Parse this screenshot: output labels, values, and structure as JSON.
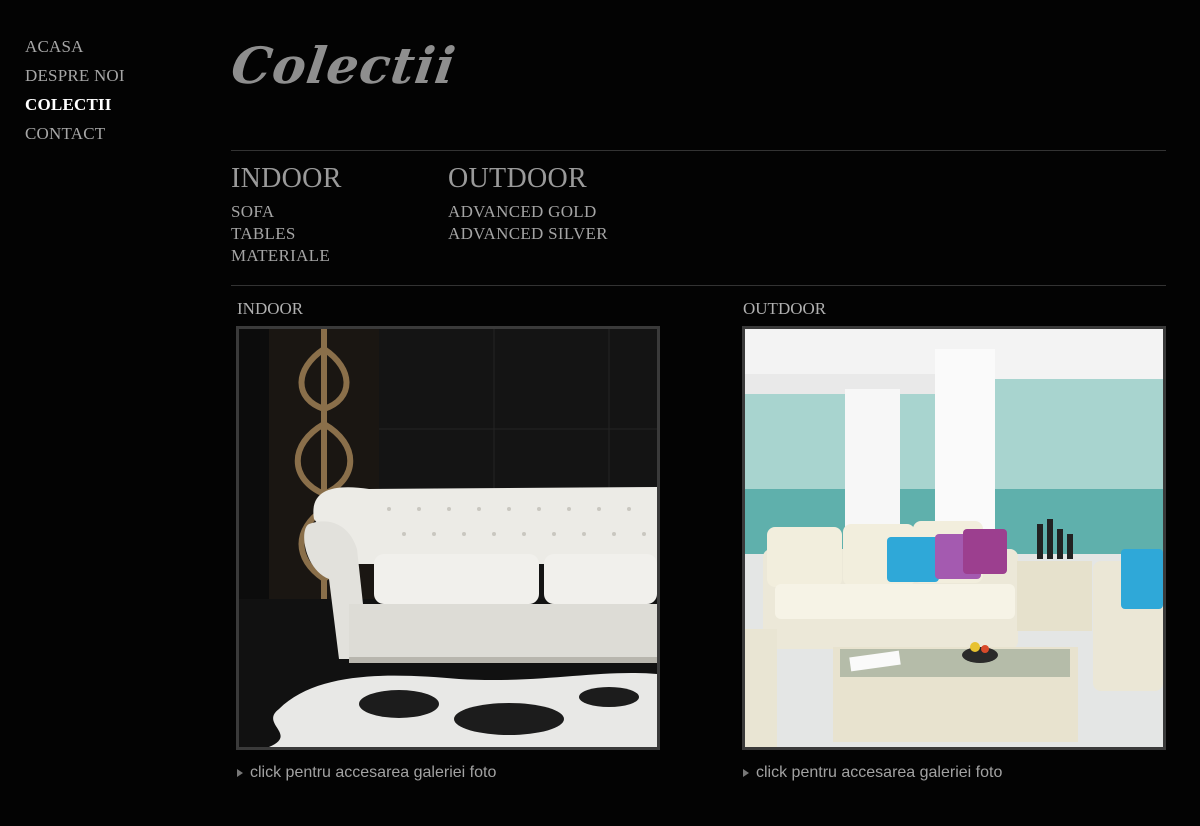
{
  "nav": {
    "items": [
      {
        "label": "ACASA",
        "active": false
      },
      {
        "label": "DESPRE NOI",
        "active": false
      },
      {
        "label": "COLECTII",
        "active": true
      },
      {
        "label": "CONTACT",
        "active": false
      }
    ]
  },
  "header": {
    "logo_text": "Colectii"
  },
  "categories": {
    "indoor": {
      "title": "INDOOR",
      "items": [
        "SOFA",
        "TABLES",
        "MATERIALE"
      ]
    },
    "outdoor": {
      "title": "OUTDOOR",
      "items": [
        "ADVANCED GOLD",
        "ADVANCED SILVER"
      ]
    }
  },
  "galleries": [
    {
      "label": "INDOOR",
      "image": "white-tufted-sofa-photo",
      "link_text": "click pentru accesarea galeriei foto"
    },
    {
      "label": "OUTDOOR",
      "image": "outdoor-wicker-lounge-photo",
      "link_text": "click pentru accesarea galeriei foto"
    }
  ],
  "colors": {
    "background": "#030303",
    "text": "#9a9a9a",
    "active_nav": "#ffffff",
    "frame_border": "#3a3a3a"
  }
}
